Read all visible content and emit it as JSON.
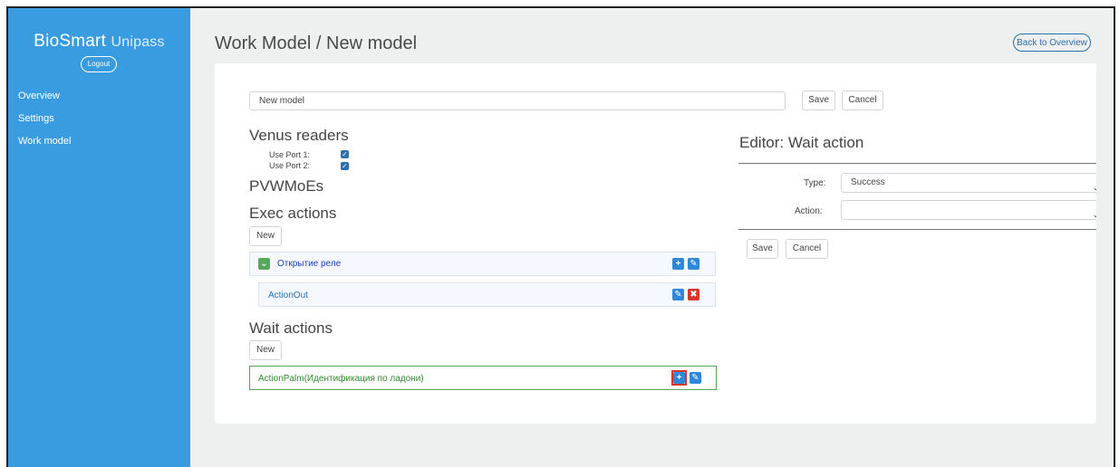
{
  "sidebar": {
    "brand_primary": "BioSmart",
    "brand_secondary": "Unipass",
    "logout_label": "Logout",
    "nav": [
      {
        "label": "Overview"
      },
      {
        "label": "Settings"
      },
      {
        "label": "Work model"
      }
    ]
  },
  "header": {
    "title": "Work Model / New model",
    "back_label": "Back to Overview"
  },
  "form": {
    "name_value": "New model",
    "save_label": "Save",
    "cancel_label": "Cancel"
  },
  "venus": {
    "title": "Venus readers",
    "port1_label": "Use Port 1:",
    "port1_checked": true,
    "port2_label": "Use Port 2:",
    "port2_checked": true
  },
  "pvwmoes_title": "PVWMoEs",
  "exec": {
    "title": "Exec actions",
    "new_label": "New",
    "group_label": "Открытие реле",
    "child_label": "ActionOut"
  },
  "wait": {
    "title": "Wait actions",
    "new_label": "New",
    "item_label": "ActionPalm(Идентификация по ладони)"
  },
  "editor": {
    "title": "Editor: Wait action",
    "type_label": "Type:",
    "type_value": "Success",
    "action_label": "Action:",
    "action_value": "",
    "save_label": "Save",
    "cancel_label": "Cancel"
  },
  "icons": {
    "expand": "chevron-down-icon",
    "add": "plus-icon",
    "edit": "edit-icon",
    "delete": "close-icon"
  },
  "colors": {
    "sidebar": "#3a9ce0",
    "primary": "#2a6fb0",
    "wait_item": "#2d8a2d",
    "danger": "#d9342b"
  }
}
